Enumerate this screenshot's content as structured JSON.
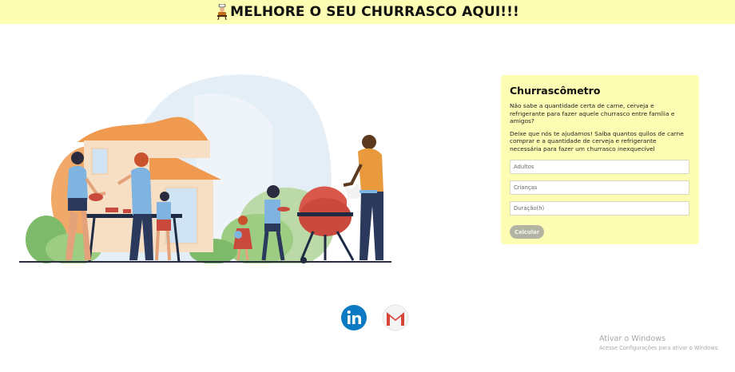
{
  "header": {
    "title": "MELHORE O SEU CHURRASCO AQUI!!!",
    "icon": "grill-chef-icon",
    "background": "#fdfdb4"
  },
  "calculator": {
    "title": "Churrascômetro",
    "intro": "Não sabe a quantidade certa de carne, cerveja e refrigerante para fazer aquele churrasco entre família e amigos?",
    "help": "Deixe que nós te ajudamos! Saiba quantos quilos de carne comprar e a quantidade de cerveja e refrigerante necessária para fazer um churrasco inexquecível",
    "fields": {
      "adults_placeholder": "Adultos",
      "children_placeholder": "Crianças",
      "duration_placeholder": "Duração(h)"
    },
    "button_label": "Calcular"
  },
  "social": {
    "linkedin_icon": "linkedin-icon",
    "gmail_icon": "gmail-icon"
  },
  "watermark": {
    "line1": "Ativar o Windows",
    "line2": "Acesse Configurações para ativar o Windows."
  }
}
